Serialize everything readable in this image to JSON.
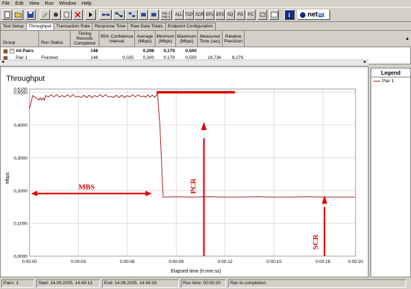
{
  "menu": [
    "File",
    "Edit",
    "View",
    "Run",
    "Window",
    "Help"
  ],
  "toolbar": {
    "text_buttons": [
      "Pair 1\nPair 2",
      "ALL",
      "TCP",
      "SCR",
      "EP1",
      "EP2",
      "SQ",
      "PG",
      "PC"
    ],
    "logo": "net"
  },
  "tabs": [
    "Test Setup",
    "Throughput",
    "Transaction Rate",
    "Response Time",
    "Raw Data Totals",
    "Endpoint Configuration"
  ],
  "active_tab": "Throughput",
  "table": {
    "headers": [
      "Group",
      "Run Status",
      "Timing Records Completed",
      "95% Confidence Interval",
      "Average (Mbps)",
      "Minimum (Mbps)",
      "Maximum (Mbps)",
      "Measured Time (sec)",
      "Relative Precision"
    ],
    "rows": [
      [
        "All Pairs",
        "",
        "148",
        "",
        "0,298",
        "0,179",
        "0,500",
        "",
        ""
      ],
      [
        "Pair 1",
        "Finished",
        "148",
        "0,025",
        "0,300",
        "0,179",
        "0,500",
        "19,736",
        "8,279"
      ]
    ]
  },
  "chart_data": {
    "type": "line",
    "title": "Throughput",
    "xlabel": "Elapsed time (h:mm:ss)",
    "ylabel": "Mbps",
    "x_ticks": [
      "0:00:00",
      "0:00:03",
      "0:00:06",
      "0:00:09",
      "0:00:12",
      "0:00:15",
      "0:00:18",
      "0:00:20"
    ],
    "y_ticks": [
      "0,0000",
      "0,1000",
      "0,2000",
      "0,3000",
      "0,4000",
      "0,5000",
      "0,5100"
    ],
    "ylim": [
      0,
      0.51
    ],
    "xlim": [
      0,
      20
    ],
    "series": [
      {
        "name": "Pair 1",
        "color": "#9b1b1b",
        "points": [
          [
            0,
            0.45
          ],
          [
            0.2,
            0.49
          ],
          [
            0.5,
            0.48
          ],
          [
            1,
            0.49
          ],
          [
            2,
            0.49
          ],
          [
            3,
            0.488
          ],
          [
            4,
            0.49
          ],
          [
            5,
            0.488
          ],
          [
            6,
            0.49
          ],
          [
            7,
            0.489
          ],
          [
            7.8,
            0.49
          ],
          [
            7.85,
            0.5
          ],
          [
            8.0,
            0.4
          ],
          [
            8.2,
            0.18
          ],
          [
            9,
            0.181
          ],
          [
            10,
            0.18
          ],
          [
            11,
            0.181
          ],
          [
            12,
            0.18
          ],
          [
            13,
            0.18
          ],
          [
            14,
            0.181
          ],
          [
            15,
            0.18
          ],
          [
            16,
            0.18
          ],
          [
            17,
            0.181
          ],
          [
            18,
            0.18
          ],
          [
            19,
            0.18
          ],
          [
            20,
            0.18
          ]
        ]
      }
    ],
    "annotations": [
      "MBS",
      "PCR",
      "SCR"
    ]
  },
  "legend": {
    "title": "Legend",
    "items": [
      {
        "label": "Pair 1",
        "color": "#9b1b1b"
      }
    ]
  },
  "status": {
    "pairs": "Pairs: 1",
    "start": "Start: 14.09.2005, 14:49:13",
    "end": "End: 14.09.2005, 14:49:33",
    "run_time": "Run time: 00:00:20",
    "state": "Ran to completion"
  }
}
